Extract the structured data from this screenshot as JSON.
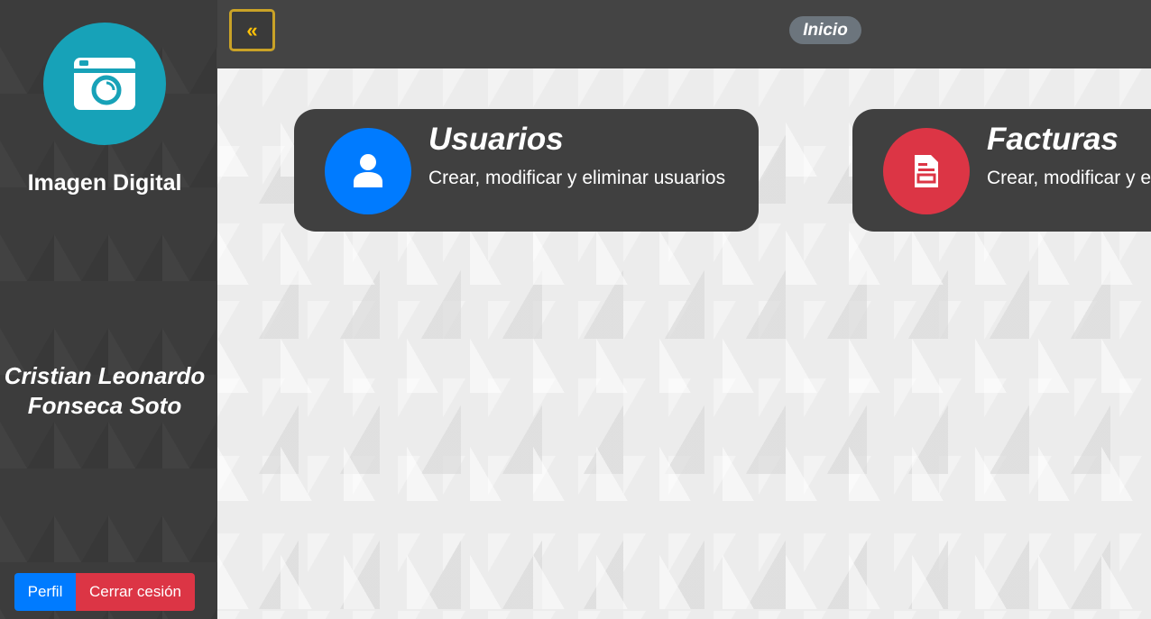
{
  "sidebar": {
    "logo_icon": "camera-icon",
    "brand": "Imagen Digital",
    "user_name": "Cristian Leonardo Fonseca Soto",
    "profile_button": "Perfil",
    "logout_button": "Cerrar cesión"
  },
  "topbar": {
    "collapse_icon": "double-chevron-left-icon",
    "collapse_glyph": "«",
    "breadcrumb": "Inicio"
  },
  "cards": [
    {
      "title": "Usuarios",
      "description": "Crear, modificar y eliminar usuarios",
      "icon": "user-icon",
      "color": "#007bff"
    },
    {
      "title": "Facturas",
      "description": "Crear, modificar y eliminar facturas",
      "icon": "invoice-icon",
      "color": "#dc3545"
    }
  ],
  "colors": {
    "accent_teal": "#17a2b8",
    "primary": "#007bff",
    "danger": "#dc3545",
    "warning": "#ffc107",
    "badge": "#6c757d"
  }
}
